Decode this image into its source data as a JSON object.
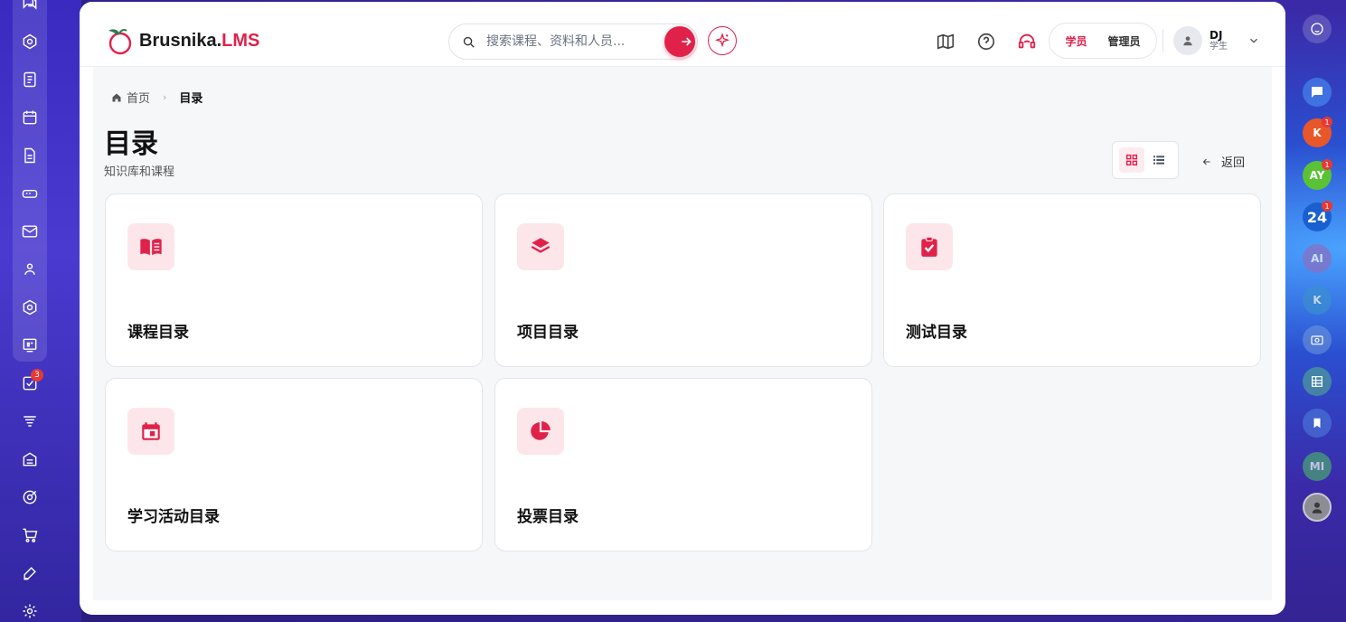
{
  "app": {
    "logo_main": "Brusnika.",
    "logo_accent": "LMS"
  },
  "search": {
    "placeholder": "搜索课程、资料和人员..."
  },
  "header": {
    "icons": [
      "map-icon",
      "help-icon",
      "support-headset-icon"
    ],
    "roles": {
      "student": "学员",
      "admin": "管理员"
    },
    "user": {
      "name": "DJ",
      "role": "学生"
    }
  },
  "breadcrumb": {
    "home": "首页",
    "current": "目录"
  },
  "page": {
    "title": "目录",
    "subtitle": "知识库和课程",
    "back_label": "返回"
  },
  "cards": [
    {
      "label": "课程目录",
      "icon": "book-open-icon"
    },
    {
      "label": "项目目录",
      "icon": "layers-icon"
    },
    {
      "label": "测试目录",
      "icon": "clipboard-check-icon"
    },
    {
      "label": "学习活动目录",
      "icon": "calendar-event-icon"
    },
    {
      "label": "投票目录",
      "icon": "pie-chart-icon"
    }
  ],
  "left_nav": {
    "badge_count": "3"
  },
  "right_rail": {
    "avatars": [
      {
        "initials": "K",
        "color": "#e8572a",
        "badge": "1"
      },
      {
        "initials": "AY",
        "color": "#5bc236",
        "badge": "1"
      },
      {
        "initials": "24",
        "color": "#1a5fd0",
        "badge": "1"
      },
      {
        "initials": "AI",
        "color": "#8b6fc0",
        "badge": ""
      },
      {
        "initials": "K",
        "color": "#3b8fd0",
        "badge": ""
      },
      {
        "initials": "MI",
        "color": "#4aa870",
        "badge": ""
      }
    ]
  },
  "colors": {
    "accent": "#e0224b",
    "icon_bg": "#fde6ea"
  }
}
